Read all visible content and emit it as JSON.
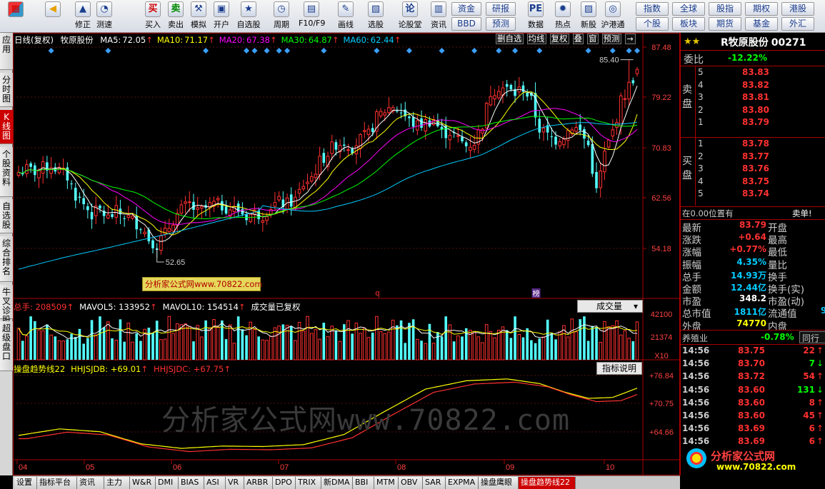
{
  "toolbar": {
    "items": [
      {
        "label": "",
        "icon": "logo-grid-icon"
      },
      {
        "label": "",
        "icon": "back-arrow-icon"
      },
      {
        "label": "修正",
        "icon": "up-arrow-icon"
      },
      {
        "label": "测速",
        "icon": "speed-icon"
      },
      {
        "label": "买入",
        "icon": "buy-icon",
        "glyph": "买"
      },
      {
        "label": "卖出",
        "icon": "sell-icon",
        "glyph": "卖"
      },
      {
        "label": "模拟",
        "icon": "hammer-icon"
      },
      {
        "label": "开户",
        "icon": "lock-icon"
      },
      {
        "label": "自选股",
        "icon": "star-icon"
      },
      {
        "label": "周期",
        "icon": "clock-icon"
      },
      {
        "label": "F10/F9",
        "icon": "f10-icon"
      },
      {
        "label": "画线",
        "icon": "pen-icon"
      },
      {
        "label": "选股",
        "icon": "select-icon"
      },
      {
        "label": "论股堂",
        "icon": "forum-icon",
        "glyph": "论"
      },
      {
        "label": "资讯",
        "icon": "news-icon"
      },
      {
        "label": "数据",
        "icon": "pe-icon",
        "glyph": "PE"
      },
      {
        "label": "热点",
        "icon": "hot-icon"
      },
      {
        "label": "新股",
        "icon": "newstock-icon"
      },
      {
        "label": "沪港通",
        "icon": "sse-hkex-icon"
      }
    ],
    "right_buttons": [
      [
        "资金",
        "研报"
      ],
      [
        "BBD",
        "预测"
      ],
      [
        "指数",
        "全球",
        "股指",
        "期权",
        "港股"
      ],
      [
        "个股",
        "板块",
        "期货",
        "基金",
        "外汇"
      ]
    ]
  },
  "left_tabs": [
    "应用",
    "分时图",
    "K线图",
    "个股资料",
    "自选股",
    "综合排名",
    "牛叉诊股",
    "超级盘口"
  ],
  "left_tab_active": "K线图",
  "chart_header": {
    "period": "日线(复权)",
    "stock": "牧原股份",
    "ma": [
      {
        "label": "MA5:",
        "value": "72.05",
        "color": "#ffffff"
      },
      {
        "label": "MA10:",
        "value": "71.17",
        "color": "#ffff00"
      },
      {
        "label": "MA20:",
        "value": "67.38",
        "color": "#ff00ff"
      },
      {
        "label": "MA30:",
        "value": "64.87",
        "color": "#00ff00"
      },
      {
        "label": "MA60:",
        "value": "62.44",
        "color": "#00ccff"
      }
    ],
    "controls": [
      "删自选",
      "均线",
      "复权",
      "叠",
      "窗",
      "预测"
    ]
  },
  "price_panel": {
    "axis": [
      "87.48",
      "79.22",
      "70.83",
      "62.56",
      "54.18"
    ],
    "max_label": "85.40",
    "min_label": "52.65",
    "watermark_box": "分析家公式网www.70822.com"
  },
  "volume_panel": {
    "header": [
      {
        "text": "总手: 208509",
        "color": "#ff3030"
      },
      {
        "text": "MAVOL5: 133952",
        "color": "#ffffff"
      },
      {
        "text": "MAVOL10: 154514",
        "color": "#ffffff"
      },
      {
        "text": "成交量已复权",
        "color": "#ffffff"
      }
    ],
    "selector": "成交量",
    "axis": [
      "42100",
      "21374",
      "X10"
    ]
  },
  "indicator_panel": {
    "header": [
      {
        "text": "操盘趋势线22",
        "color": "#ffff00"
      },
      {
        "text": "HHJSJDB: +69.01",
        "color": "#ffff00"
      },
      {
        "text": "HHJSJDC: +67.75",
        "color": "#ff3030"
      }
    ],
    "button": "指标说明",
    "axis": [
      "+76.84",
      "+70.75",
      "+64.66"
    ],
    "watermark": "分析家公式网www.70822.com"
  },
  "x_axis": [
    "04",
    "05",
    "06",
    "07",
    "08",
    "09",
    "10"
  ],
  "right_panel": {
    "title": "R牧原股份",
    "code": "00271",
    "wei_bi_label": "委比",
    "wei_bi": "-12.22%",
    "sell_label": "卖盘",
    "buy_label": "买盘",
    "sell": [
      [
        "5",
        "83.83"
      ],
      [
        "4",
        "83.82"
      ],
      [
        "3",
        "83.81"
      ],
      [
        "2",
        "83.80"
      ],
      [
        "1",
        "83.79"
      ]
    ],
    "buy": [
      [
        "1",
        "83.78"
      ],
      [
        "2",
        "83.77"
      ],
      [
        "3",
        "83.76"
      ],
      [
        "4",
        "83.75"
      ],
      [
        "5",
        "83.74"
      ]
    ],
    "position_text": "在0.00位置有",
    "sell_one": "卖单!",
    "quotes": [
      [
        "最新",
        "83.79",
        "开盘"
      ],
      [
        "涨跌",
        "+0.64",
        "最高"
      ],
      [
        "涨幅",
        "+0.77%",
        "最低"
      ],
      [
        "振幅",
        "4.35%",
        "量比"
      ],
      [
        "总手",
        "14.93万",
        "换手"
      ],
      [
        "金额",
        "12.44亿",
        "换手(实)"
      ],
      [
        "市盈",
        "348.2",
        "市盈(动)"
      ],
      [
        "总市值",
        "1811亿",
        "流通值"
      ],
      [
        "外盘",
        "74770",
        "内盘"
      ]
    ],
    "quote_value_colors": [
      "#ff3030",
      "#ff3030",
      "#ff3030",
      "#00ccff",
      "#00ccff",
      "#00ccff",
      "#ffffff",
      "#00ccff",
      "#ffff00"
    ],
    "flow_value_tail": "9",
    "industry": "养殖业",
    "industry_change": "-0.78%",
    "industry_tab": "同行",
    "ticks": [
      [
        "14:56",
        "83.75",
        "22",
        "#ff3030"
      ],
      [
        "14:56",
        "83.70",
        "7",
        "#00ff00"
      ],
      [
        "14:56",
        "83.72",
        "54",
        "#ff3030"
      ],
      [
        "14:56",
        "83.60",
        "131",
        "#00ff00"
      ],
      [
        "14:56",
        "83.60",
        "8",
        "#ff3030"
      ],
      [
        "14:56",
        "83.60",
        "45",
        "#ff3030"
      ],
      [
        "14:56",
        "83.69",
        "6",
        "#ff3030"
      ],
      [
        "14:56",
        "83.69",
        "6",
        "#ff3030"
      ]
    ],
    "logo_text": "分析家公式网",
    "logo_url": "www.70822.com"
  },
  "bottom_tabs": [
    "设置",
    "指标平台",
    "资讯",
    "主力",
    "W&R",
    "DMI",
    "BIAS",
    "ASI",
    "VR",
    "ARBR",
    "DPO",
    "TRIX",
    "新DMA",
    "BBI",
    "MTM",
    "OBV",
    "SAR",
    "EXPMA",
    "操盘鹰眼",
    "操盘趋势线22"
  ],
  "bottom_tab_active": "操盘趋势线22",
  "chart_data": {
    "type": "candlestick",
    "symbol": "牧原股份",
    "period": "日线(复权)",
    "x": [
      "04",
      "05",
      "06",
      "07",
      "08",
      "09",
      "10"
    ],
    "price_axis": {
      "ticks": [
        87.48,
        79.22,
        70.83,
        62.56,
        54.18
      ],
      "range": [
        49.5,
        89.0
      ]
    },
    "price_path": [
      [
        0,
        66.8
      ],
      [
        2,
        67.2
      ],
      [
        4,
        66.9
      ],
      [
        6,
        67.5
      ],
      [
        8,
        68.0
      ],
      [
        10,
        67.0
      ],
      [
        12,
        66.0
      ],
      [
        14,
        63.0
      ],
      [
        16,
        61.5
      ],
      [
        18,
        59.8
      ],
      [
        20,
        60.5
      ],
      [
        22,
        59.2
      ],
      [
        24,
        60.2
      ],
      [
        26,
        59.6
      ],
      [
        28,
        58.8
      ],
      [
        30,
        58.0
      ],
      [
        32,
        55.8
      ],
      [
        34,
        54.8
      ],
      [
        36,
        56.6
      ],
      [
        38,
        59.0
      ],
      [
        40,
        60.5
      ],
      [
        42,
        61.5
      ],
      [
        44,
        60.0
      ],
      [
        46,
        60.8
      ],
      [
        48,
        61.5
      ],
      [
        50,
        61.2
      ],
      [
        52,
        60.8
      ],
      [
        54,
        60.4
      ],
      [
        56,
        59.6
      ],
      [
        58,
        60.0
      ],
      [
        60,
        59.8
      ],
      [
        62,
        61.2
      ],
      [
        64,
        61.8
      ],
      [
        66,
        61.5
      ],
      [
        68,
        62.2
      ],
      [
        70,
        64.8
      ],
      [
        72,
        66.0
      ],
      [
        74,
        68.5
      ],
      [
        76,
        70.0
      ],
      [
        78,
        71.5
      ],
      [
        80,
        71.8
      ],
      [
        82,
        71.0
      ],
      [
        84,
        72.2
      ],
      [
        86,
        73.0
      ],
      [
        88,
        75.8
      ],
      [
        90,
        77.0
      ],
      [
        92,
        77.8
      ],
      [
        94,
        76.8
      ],
      [
        96,
        75.2
      ],
      [
        98,
        74.5
      ],
      [
        100,
        75.0
      ],
      [
        102,
        75.6
      ],
      [
        104,
        73.2
      ],
      [
        106,
        73.5
      ],
      [
        108,
        72.2
      ],
      [
        110,
        71.2
      ],
      [
        112,
        71.8
      ],
      [
        114,
        74.8
      ],
      [
        116,
        80.0
      ],
      [
        118,
        81.0
      ],
      [
        120,
        80.5
      ],
      [
        122,
        79.8
      ],
      [
        124,
        80.8
      ],
      [
        126,
        78.5
      ],
      [
        128,
        74.0
      ],
      [
        130,
        72.8
      ],
      [
        132,
        72.2
      ],
      [
        134,
        73.0
      ],
      [
        136,
        74.5
      ],
      [
        138,
        73.5
      ],
      [
        140,
        71.2
      ],
      [
        142,
        63.5
      ],
      [
        144,
        69.8
      ],
      [
        146,
        73.5
      ],
      [
        148,
        78.5
      ],
      [
        150,
        81.0
      ],
      [
        152,
        83.8
      ]
    ],
    "price_high": 85.4,
    "price_low": 52.65,
    "ma_last": {
      "MA5": 72.05,
      "MA10": 71.17,
      "MA20": 67.38,
      "MA30": 64.87,
      "MA60": 62.44
    },
    "volume": {
      "total": 208509,
      "MAVOL5": 133952,
      "MAVOL10": 154514,
      "axis_ticks": [
        42100,
        21374
      ],
      "unit": "X10"
    },
    "indicator": {
      "name": "操盘趋势线22",
      "HHJSJDB": 69.01,
      "HHJSJDC": 67.75,
      "axis_ticks": [
        76.84,
        70.75,
        64.66
      ]
    }
  }
}
